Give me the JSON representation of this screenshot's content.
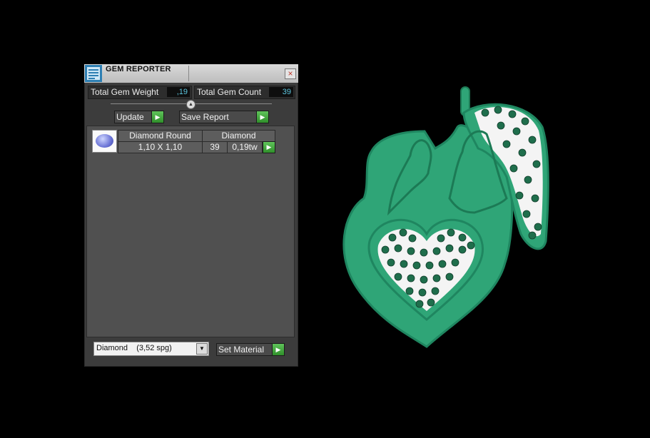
{
  "window": {
    "title": "GEM REPORTER",
    "close_symbol": "×"
  },
  "stats": {
    "total_weight_label": "Total Gem Weight",
    "total_weight_value": ",19",
    "total_count_label": "Total Gem Count",
    "total_count_value": "39"
  },
  "collapse_symbol": "▲",
  "buttons": {
    "update": "Update",
    "save_report": "Save Report",
    "arrow": "▶",
    "set_material": "Set Material"
  },
  "gem_list": {
    "headers": [
      "Diamond Round",
      "Diamond"
    ],
    "rows": [
      {
        "size": "1,10 X 1,10",
        "count": "39",
        "weight": "0,19tw"
      }
    ]
  },
  "material": {
    "selected": "Diamond    (3,52 spg)",
    "dropdown_symbol": "▼"
  },
  "colors": {
    "model_green": "#2fa577",
    "stone_green": "#1f6e4c",
    "accent_value": "#5dc7e0",
    "button_green": "#3fa63a"
  }
}
